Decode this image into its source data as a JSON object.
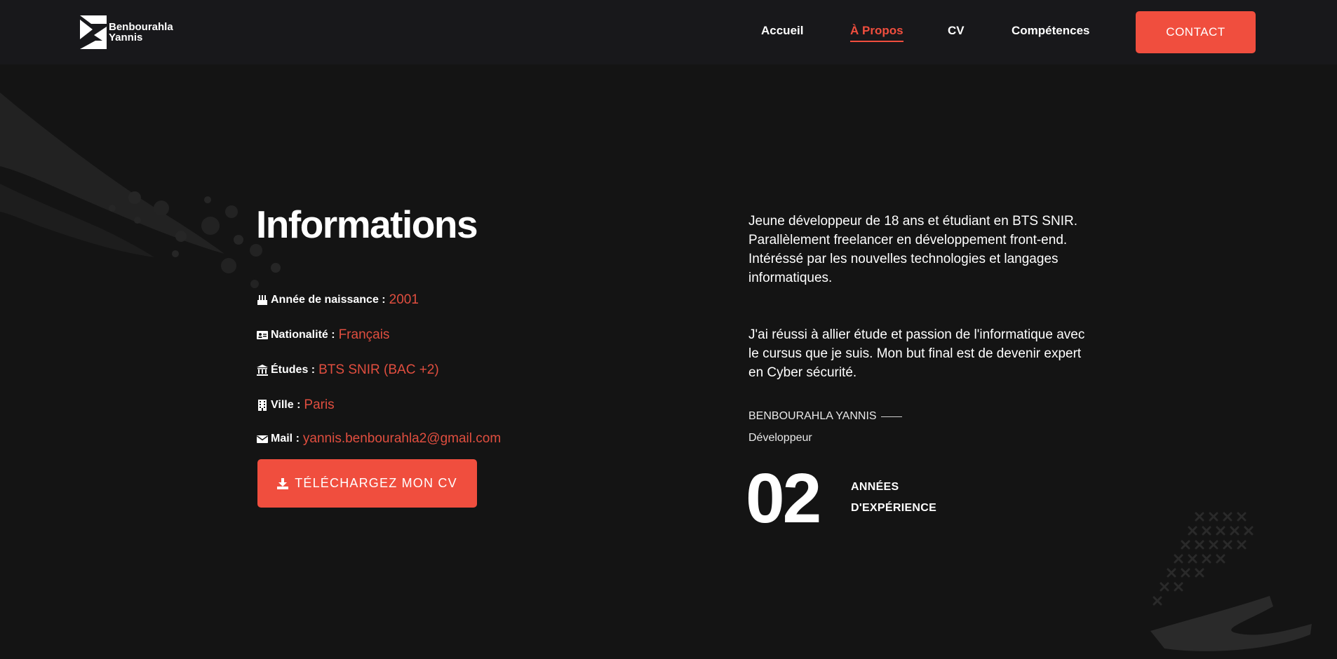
{
  "logo": {
    "line1": "Benbourahla",
    "line2": "Yannis",
    "icon": "bz-monogram-logo"
  },
  "nav": {
    "items": [
      {
        "label": "Accueil",
        "active": false
      },
      {
        "label": "À Propos",
        "active": true
      },
      {
        "label": "CV",
        "active": false
      },
      {
        "label": "Compétences",
        "active": false
      }
    ],
    "contact_label": "CONTACT"
  },
  "colors": {
    "accent": "#f04e3e",
    "background": "#141414",
    "header": "#18181b"
  },
  "info": {
    "title": "Informations",
    "rows": [
      {
        "icon": "birthday-cake-icon",
        "label": "Année de naissance :",
        "value": "2001"
      },
      {
        "icon": "id-card-icon",
        "label": "Nationalité :",
        "value": "Français"
      },
      {
        "icon": "university-icon",
        "label": "Études :",
        "value": "BTS SNIR (BAC +2)"
      },
      {
        "icon": "building-icon",
        "label": "Ville :",
        "value": "Paris"
      },
      {
        "icon": "envelope-icon",
        "label": "Mail :",
        "value": "yannis.benbourahla2@gmail.com"
      }
    ],
    "download_label": "TÉLÉCHARGEZ MON CV",
    "download_icon": "download-icon"
  },
  "about": {
    "paragraph1": "Jeune développeur de 18 ans et étudiant en BTS SNIR. Parallèlement freelancer en développement front-end. Intéréssé par les nouvelles technologies et langages informatiques.",
    "paragraph2": "J'ai réussi à allier étude et passion de l'informatique avec le cursus que je suis. Mon but final est de devenir expert en Cyber sécurité.",
    "signature_name": "BENBOURAHLA YANNIS",
    "signature_role": "Développeur",
    "years_number": "02",
    "years_label_line1": "ANNÉES",
    "years_label_line2": "D'EXPÉRIENCE"
  }
}
